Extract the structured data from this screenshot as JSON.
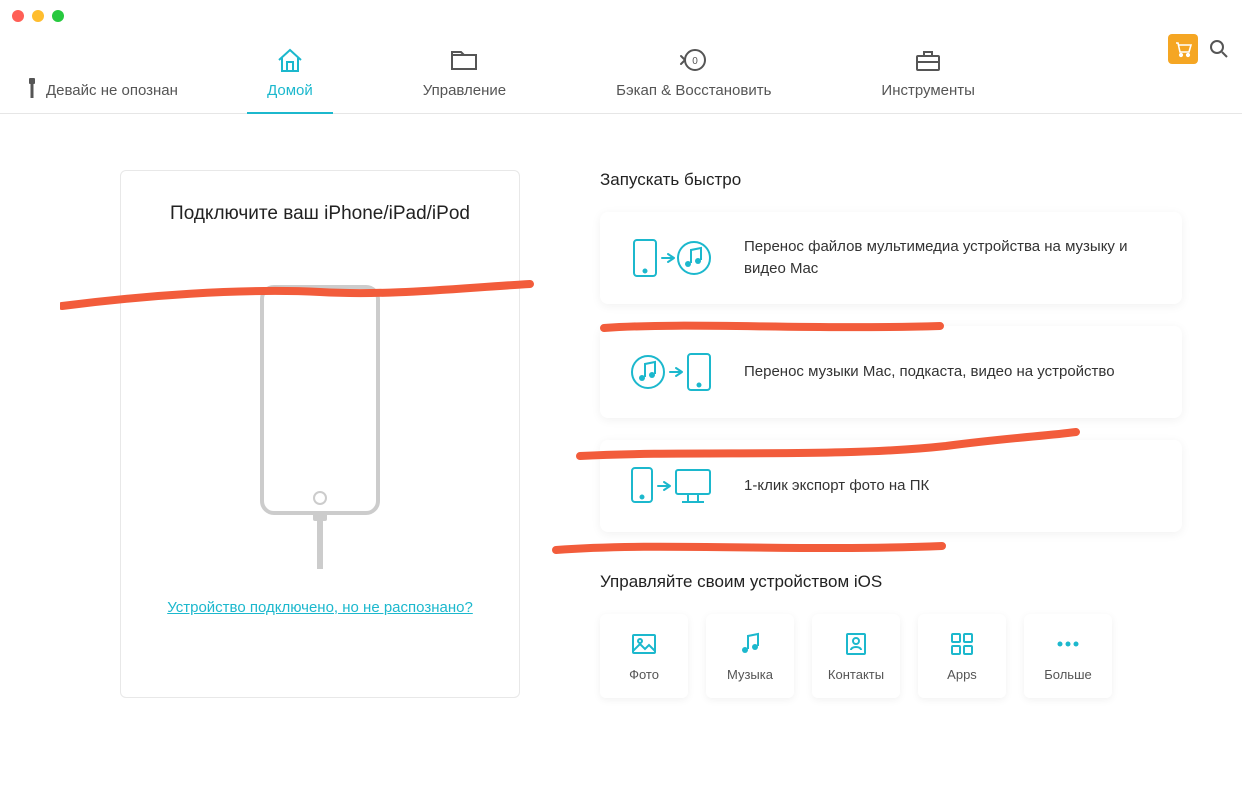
{
  "device_status": "Девайс не опознан",
  "nav": {
    "home": "Домой",
    "manage": "Управление",
    "backup": "Бэкап & Восстановить",
    "tools": "Инструменты"
  },
  "connect": {
    "title": "Подключите ваш iPhone/iPad/iPod",
    "help_link": "Устройство подключено, но не распознано?"
  },
  "quick": {
    "section_title": "Запускать быстро",
    "card1": "Перенос файлов мультимедиа устройства на музыку и видео Mac",
    "card2": "Перенос музыки Mac, подкаста, видео на устройство",
    "card3": "1-клик экспорт фото на ПК"
  },
  "manage": {
    "section_title": "Управляйте своим устройством iOS",
    "photo": "Фото",
    "music": "Музыка",
    "contacts": "Контакты",
    "apps": "Apps",
    "more": "Больше"
  },
  "colors": {
    "accent": "#1cb8cd",
    "warn_red": "#f25c3b",
    "orange": "#f5a623"
  }
}
